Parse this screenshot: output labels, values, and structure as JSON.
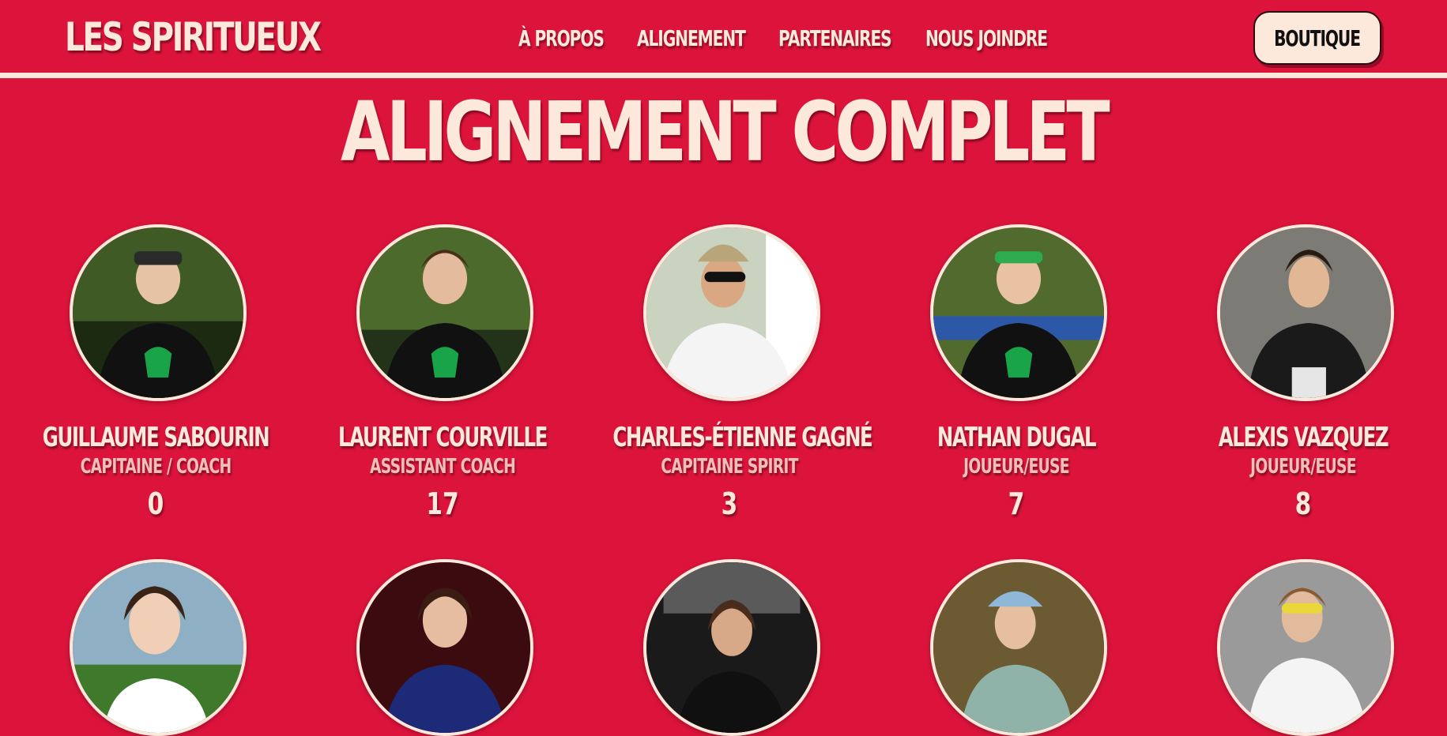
{
  "site": {
    "logo": "LES SPIRITUEUX"
  },
  "nav": {
    "items": [
      "À PROPOS",
      "ALIGNEMENT",
      "PARTENAIRES",
      "NOUS JOINDRE"
    ],
    "shop_label": "BOUTIQUE"
  },
  "page": {
    "title": "ALIGNEMENT COMPLET"
  },
  "roster": {
    "players": [
      {
        "name": "GUILLAUME SABOURIN",
        "role": "CAPITAINE / COACH",
        "number": "0"
      },
      {
        "name": "LAURENT COURVILLE",
        "role": "ASSISTANT COACH",
        "number": "17"
      },
      {
        "name": "CHARLES-ÉTIENNE GAGNÉ",
        "role": "CAPITAINE SPIRIT",
        "number": "3"
      },
      {
        "name": "NATHAN DUGAL",
        "role": "JOUEUR/EUSE",
        "number": "7"
      },
      {
        "name": "ALEXIS VAZQUEZ",
        "role": "JOUEUR/EUSE",
        "number": "8"
      }
    ],
    "second_row_photos": 5
  },
  "colors": {
    "background": "#dc143c",
    "cream": "#fde8dc",
    "button_text": "#111111"
  }
}
